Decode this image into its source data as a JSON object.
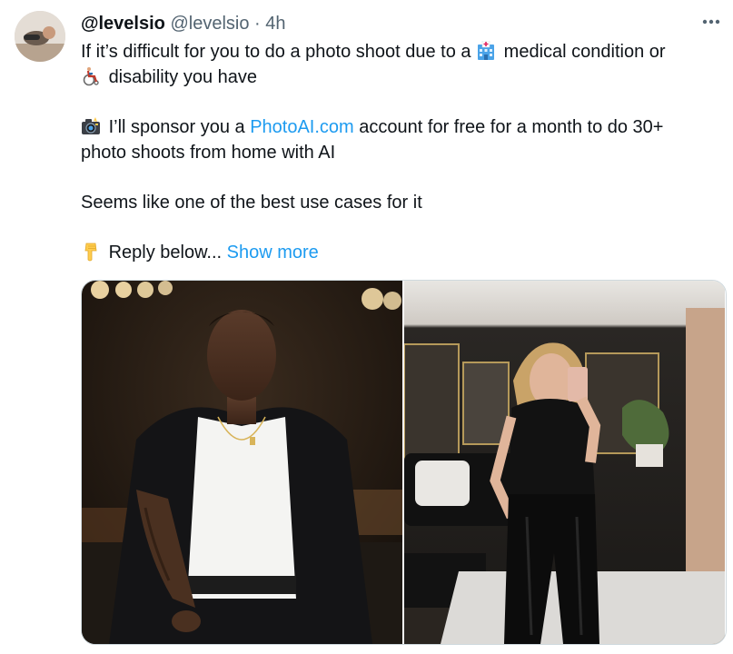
{
  "author": {
    "display_name": "@levelsio",
    "handle": "@levelsio",
    "separator": "·",
    "time": "4h"
  },
  "more_icon": "ellipsis-icon",
  "tweet": {
    "line1_a": "If it’s difficult for you to do a photo shoot due to a",
    "line1_b": "medical condition or",
    "line2": "disability you have",
    "line3_a": "I’ll sponsor you a",
    "line3_link": "PhotoAI.com",
    "line3_b": "account for free for a month to do 30+",
    "line4": "photo shoots from home with AI",
    "line5": "Seems like one of the best use cases for it",
    "line6": "Reply below...",
    "show_more": "Show more"
  },
  "icons": {
    "hospital": "hospital-emoji-icon",
    "wheelchair": "wheelchair-emoji-icon",
    "camera": "camera-flash-emoji-icon",
    "point_down": "pointing-down-emoji-icon"
  },
  "media": [
    {
      "description_icon": "photo-man-black-blazer"
    },
    {
      "description_icon": "photo-woman-leather-pants-selfie"
    }
  ],
  "colors": {
    "link": "#1d9bf0",
    "secondary_text": "#536471",
    "border": "#cfd9de"
  }
}
